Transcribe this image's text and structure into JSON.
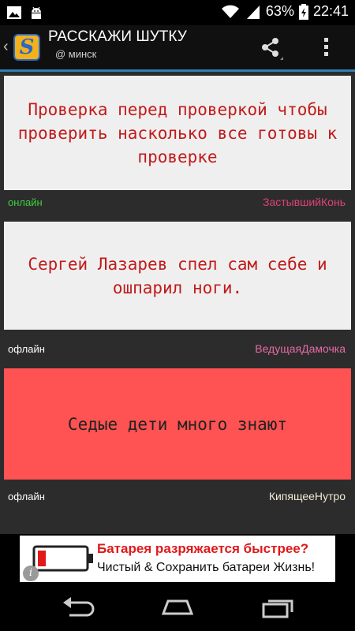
{
  "status_bar": {
    "battery": "63%",
    "time": "22:41",
    "icons": [
      "image-icon",
      "android-icon",
      "wifi-icon",
      "signal-icon",
      "battery-icon"
    ]
  },
  "app_bar": {
    "title": "РАССКАЖИ ШУТКУ",
    "subtitle": "@ минск",
    "icons": [
      "app-logo",
      "share-icon",
      "overflow-menu-icon"
    ]
  },
  "posts": [
    {
      "text": "Проверка перед проверкой чтобы проверить насколько все готовы к проверке",
      "status": "онлайн",
      "status_color": "#3ecf3e",
      "author": "ЗастывшийКонь",
      "author_color": "#e0407a",
      "bg": "#efefef",
      "text_color": "#c11b1b"
    },
    {
      "text": "Сергей Лазарев спел сам себе и ошпарил ноги.",
      "status": "офлайн",
      "status_color": "#ffffff",
      "author": "ВедущаяДамочка",
      "author_color": "#e86aa6",
      "bg": "#efefef",
      "text_color": "#c11b1b"
    },
    {
      "text": "Седые дети много знают",
      "status": "офлайн",
      "status_color": "#ffffff",
      "author": "КипящееНутро",
      "author_color": "#f1ecd0",
      "bg": "#ff5252",
      "text_color": "#222222"
    }
  ],
  "ad": {
    "headline": "Батарея разряжается быстрее?",
    "body": "Чистый & Сохранить батареи Жизнь!",
    "info_glyph": "i"
  },
  "nav_bar": {
    "icons": [
      "back-icon",
      "home-icon",
      "recent-apps-icon"
    ]
  }
}
